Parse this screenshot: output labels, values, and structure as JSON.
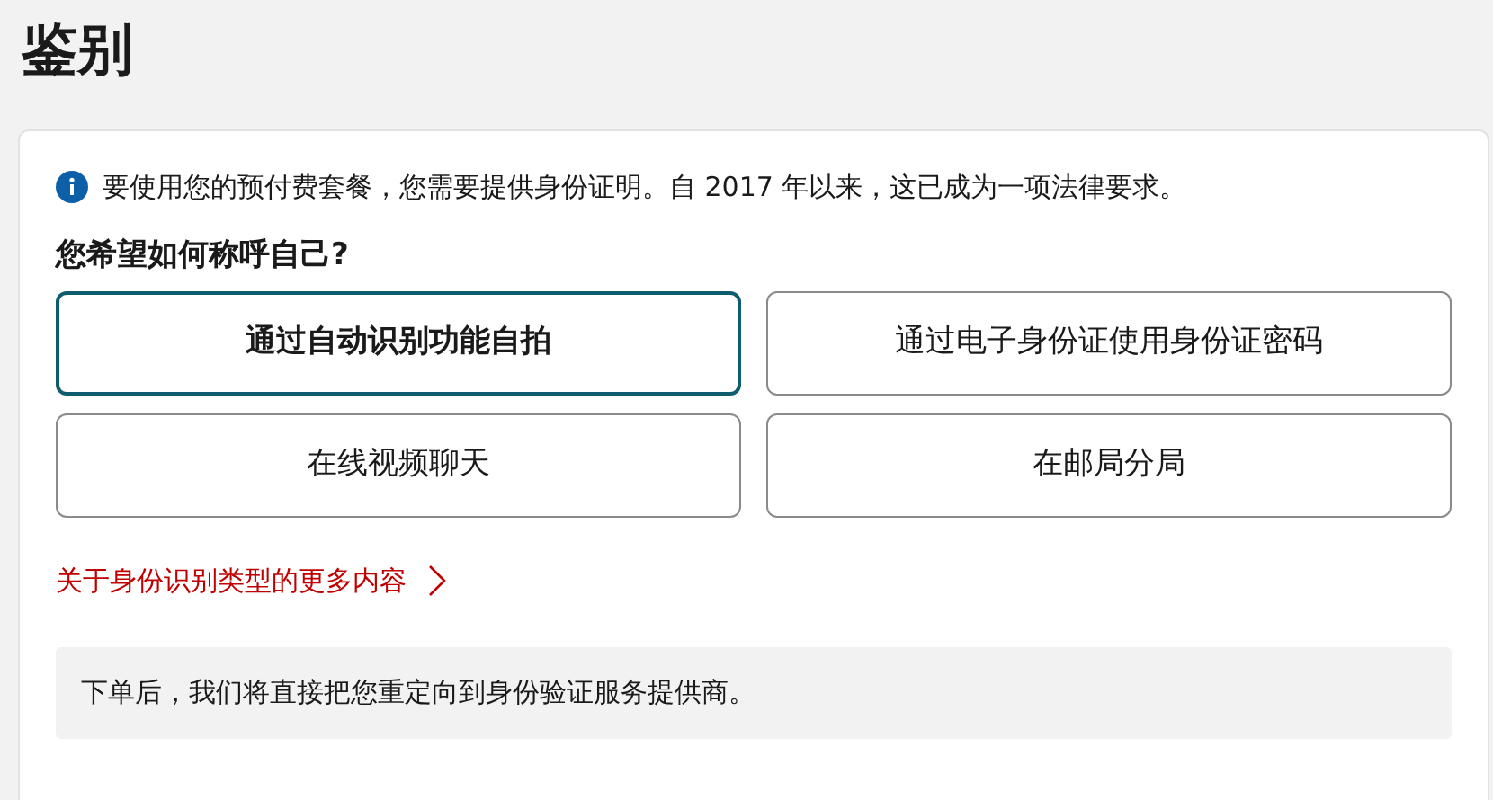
{
  "page": {
    "title": "鉴别"
  },
  "notice": {
    "text": "要使用您的预付费套餐，您需要提供身份证明。自 2017 年以来，这已成为一项法律要求。"
  },
  "question": "您希望如何称呼自己?",
  "options": [
    {
      "label": "通过自动识别功能自拍",
      "selected": true
    },
    {
      "label": "通过电子身份证使用身份证密码",
      "selected": false
    },
    {
      "label": "在线视频聊天",
      "selected": false
    },
    {
      "label": "在邮局分局",
      "selected": false
    }
  ],
  "more_link": "关于身份识别类型的更多内容",
  "note": "下单后，我们将直接把您重定向到身份验证服务提供商。"
}
